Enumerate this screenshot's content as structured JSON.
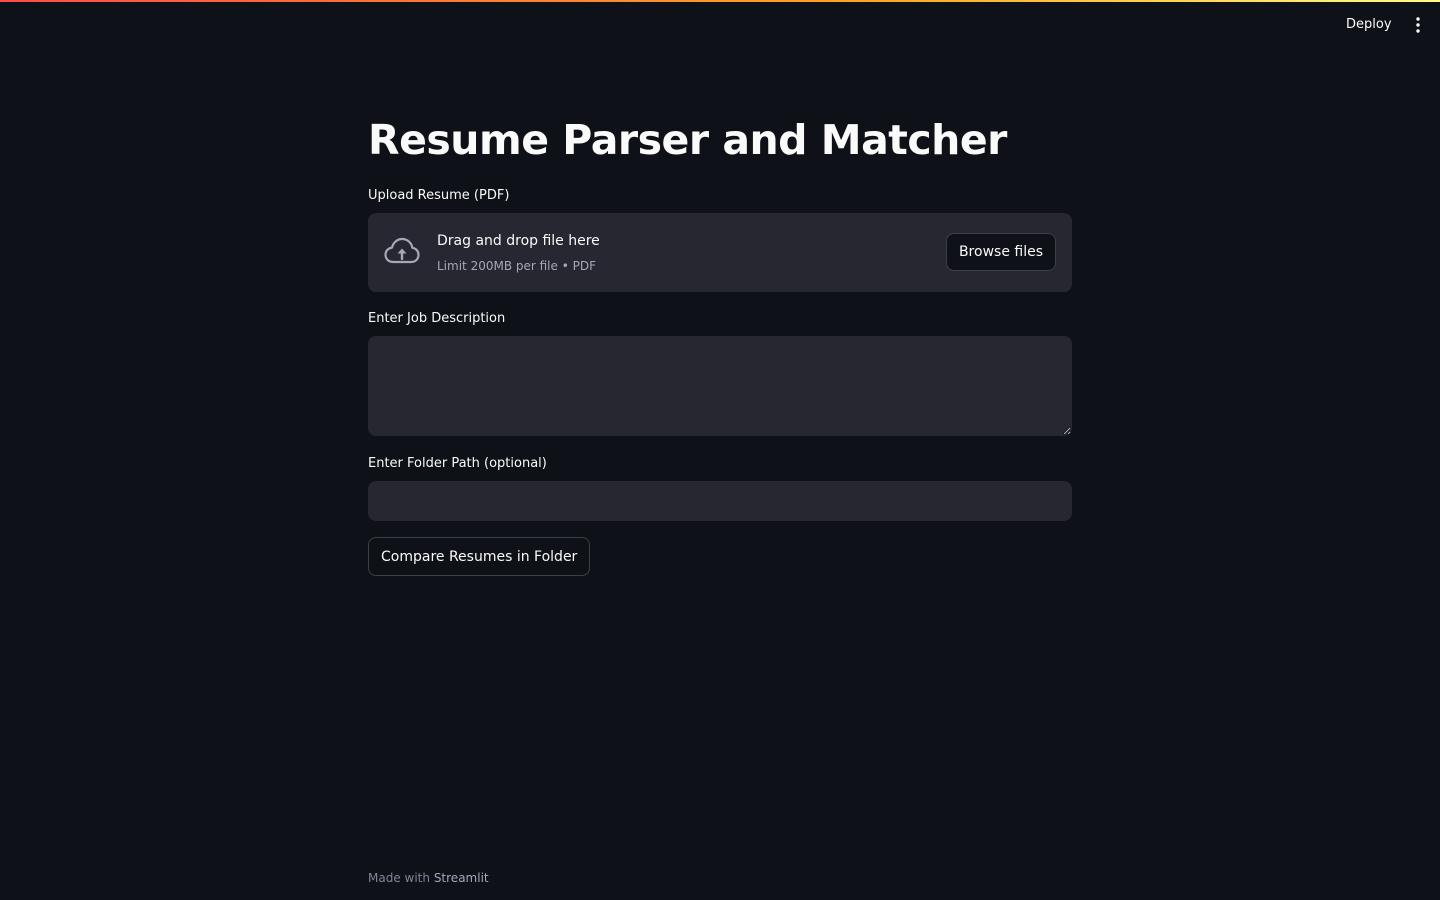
{
  "header": {
    "deploy_label": "Deploy",
    "menu_icon": "vertical-ellipsis-icon",
    "top_bar_colors": [
      "#ff4b4b",
      "#ffa421",
      "#fffd80"
    ]
  },
  "main": {
    "title": "Resume Parser and Matcher",
    "uploader": {
      "label": "Upload Resume (PDF)",
      "icon": "cloud-upload-icon",
      "drop_title": "Drag and drop file here",
      "drop_subtitle": "Limit 200MB per file • PDF",
      "browse_label": "Browse files"
    },
    "job_description": {
      "label": "Enter Job Description",
      "value": ""
    },
    "folder_path": {
      "label": "Enter Folder Path (optional)",
      "value": ""
    },
    "compare_button_label": "Compare Resumes in Folder"
  },
  "footer": {
    "prefix": "Made with",
    "link_text": "Streamlit"
  },
  "colors": {
    "background": "#0e1117",
    "surface": "#262730",
    "text": "#fafafa",
    "muted_text": "#a3a8b8"
  }
}
